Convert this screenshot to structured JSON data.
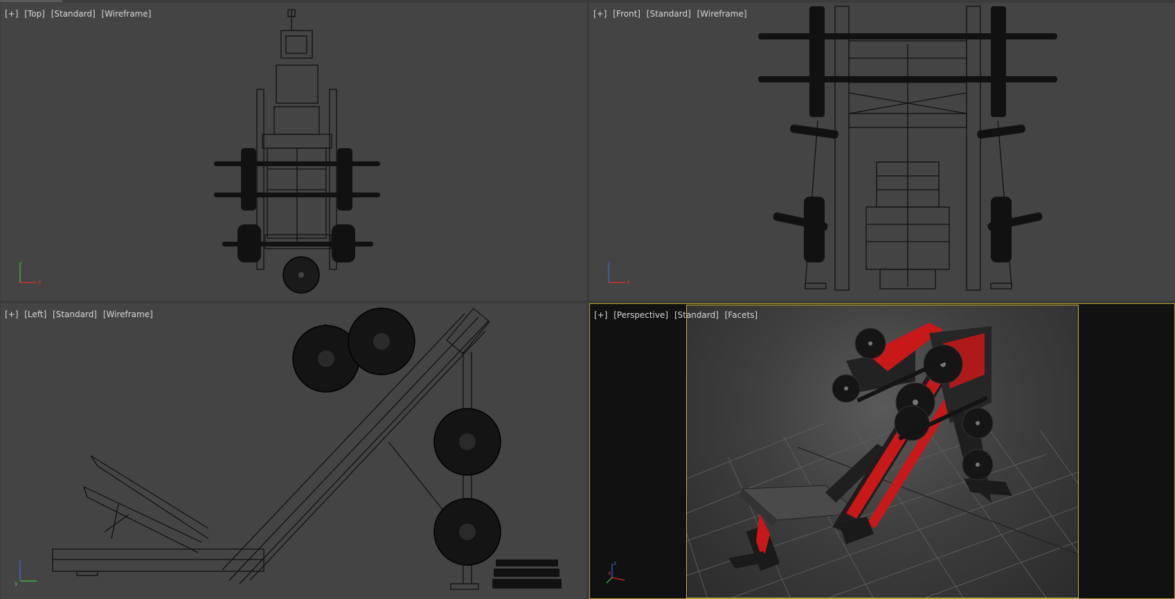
{
  "viewports": {
    "top": {
      "items": [
        "[+]",
        "[Top]",
        "[Standard]",
        "[Wireframe]"
      ]
    },
    "front": {
      "items": [
        "[+]",
        "[Front]",
        "[Standard]",
        "[Wireframe]"
      ]
    },
    "left": {
      "items": [
        "[+]",
        "[Left]",
        "[Standard]",
        "[Wireframe]"
      ]
    },
    "perspective": {
      "items": [
        "[+]",
        "[Perspective]",
        "[Standard]",
        "[Facets]"
      ]
    }
  },
  "axes": {
    "x": "x",
    "y": "y",
    "z": "z"
  },
  "colors": {
    "viewport_bg": "#444444",
    "wire": "#101010",
    "active_border": "#b8a02e",
    "machine_red": "#c81818",
    "axis_x": "#e0302a",
    "axis_y": "#3cc83c",
    "axis_z": "#3a6ae0"
  },
  "icons": [
    "axis-gizmo-icon"
  ]
}
